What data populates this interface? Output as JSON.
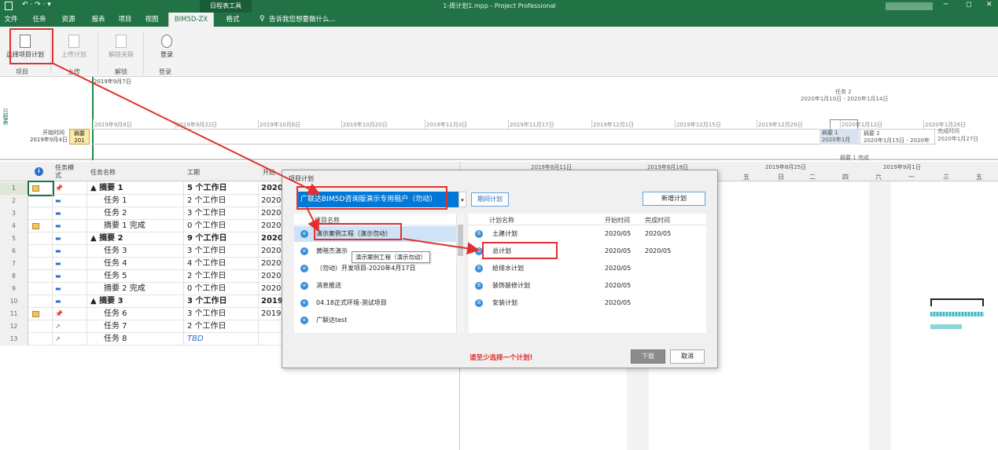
{
  "titlebar": {
    "context_tab": "日程表工具",
    "document": "1-周计划1.mpp - Project Professional"
  },
  "tabs": [
    "文件",
    "任务",
    "资源",
    "报表",
    "项目",
    "视图",
    "BIM5D-ZX",
    "格式"
  ],
  "tell_me": "告诉我您想要做什么...",
  "ribbon": {
    "buttons": [
      "选择项目计划",
      "上传计划",
      "解除关联",
      "登录"
    ],
    "groups": [
      "项目",
      "上传",
      "解锁",
      "登录"
    ]
  },
  "timeline": {
    "today": "2019年9月7日",
    "start_label": "开始时间",
    "start_date": "2019年9月4日",
    "ticks": [
      "2019年9月8日",
      "2019年9月22日",
      "2019年10月6日",
      "2019年10月20日",
      "2019年11月3日",
      "2019年11月17日",
      "2019年12月1日",
      "2019年12月15日",
      "2019年12月29日",
      "2020年1月12日",
      "2020年1月26日"
    ],
    "task2_label": "任务 2",
    "task2_dates": "2020年1月10日 - 2020年1月14日",
    "summary1": "摘要 1",
    "summary1_date": "2020年1月",
    "summary2": "摘要 2",
    "summary2_dates": "2020年1月15日 - 2020年",
    "finish_label": "完成时间",
    "finish_date": "2020年1月27日",
    "bar_label": "摘要",
    "bar_sub": "201",
    "milestone": "摘要 1 完成"
  },
  "grid": {
    "headers": {
      "mode": "任务模式",
      "name": "任务名称",
      "dur": "工期",
      "start": "开始"
    },
    "rows": [
      {
        "n": "1",
        "name": "▲ 摘要 1",
        "dur": "5 个工作日",
        "start": "2020",
        "bold": true
      },
      {
        "n": "2",
        "name": "任务 1",
        "dur": "2 个工作日",
        "start": "2020",
        "bold": false
      },
      {
        "n": "3",
        "name": "任务 2",
        "dur": "3 个工作日",
        "start": "2020",
        "bold": false
      },
      {
        "n": "4",
        "name": "摘要 1 完成",
        "dur": "0 个工作日",
        "start": "2020",
        "bold": false
      },
      {
        "n": "5",
        "name": "▲ 摘要 2",
        "dur": "9 个工作日",
        "start": "2020",
        "bold": true
      },
      {
        "n": "6",
        "name": "任务 3",
        "dur": "3 个工作日",
        "start": "2020",
        "bold": false
      },
      {
        "n": "7",
        "name": "任务 4",
        "dur": "4 个工作日",
        "start": "2020",
        "bold": false
      },
      {
        "n": "8",
        "name": "任务 5",
        "dur": "2 个工作日",
        "start": "2020",
        "bold": false
      },
      {
        "n": "9",
        "name": "摘要 2 完成",
        "dur": "0 个工作日",
        "start": "2020",
        "bold": false
      },
      {
        "n": "10",
        "name": "▲ 摘要 3",
        "dur": "3 个工作日",
        "start": "2019",
        "bold": true
      },
      {
        "n": "11",
        "name": "任务 6",
        "dur": "3 个工作日",
        "start": "2019",
        "bold": false
      },
      {
        "n": "12",
        "name": "任务 7",
        "dur": "2 个工作日",
        "start": "",
        "bold": false
      },
      {
        "n": "13",
        "name": "任务 8",
        "dur": "TBD",
        "start": "",
        "bold": false
      }
    ]
  },
  "gantt": {
    "weeks": [
      "2019年8月11日",
      "2019年8月18日",
      "2019年8月25日",
      "2019年9月1日"
    ],
    "days": [
      "五",
      "日",
      "二",
      "四",
      "六",
      "一",
      "三",
      "五"
    ]
  },
  "dialog": {
    "title": "项目计划",
    "tenant": "广联达BIM5D咨询版演示专用租户（勿动）",
    "sync_button": "期间计划",
    "new_button": "新增计划",
    "project_header": "项目名称",
    "projects": [
      "演示案例工程（演示勿动）",
      "黄晓杰演示",
      "（勿动）开发项目-2020年4月17日",
      "消息推送",
      "04.18正式环境-测试项目",
      "广联达test"
    ],
    "tooltip": "演示案例工程（演示勿动）",
    "plan_headers": [
      "计划名称",
      "开始时间",
      "完成时间"
    ],
    "plans": [
      {
        "name": "土建计划",
        "start": "2020/05",
        "end": "2020/05"
      },
      {
        "name": "总计划",
        "start": "2020/05",
        "end": "2020/05"
      },
      {
        "name": "给排水计划",
        "start": "2020/05",
        "end": ""
      },
      {
        "name": "装饰装修计划",
        "start": "2020/05",
        "end": ""
      },
      {
        "name": "安装计划",
        "start": "2020/05",
        "end": ""
      }
    ],
    "warning": "请至少选择一个计划!",
    "ok": "下载",
    "cancel": "取消"
  },
  "colors": {
    "accent": "#217346",
    "highlight": "#0078d7",
    "annotation": "#e03030"
  }
}
